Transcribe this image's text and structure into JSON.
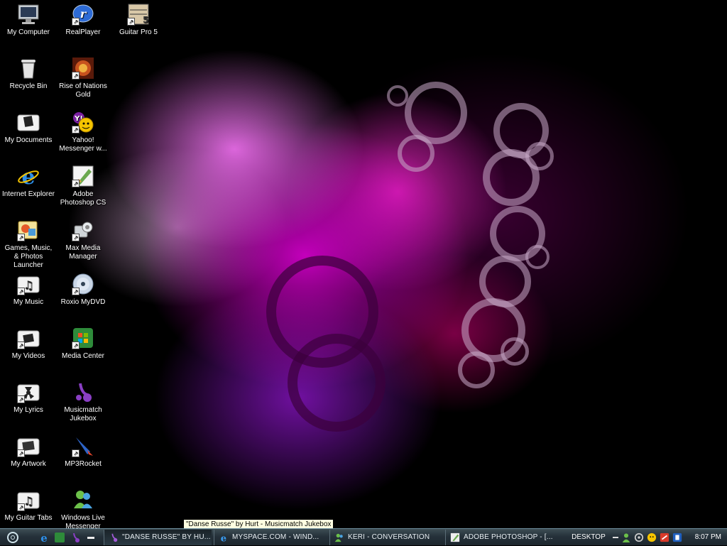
{
  "desktop": {
    "column1": [
      {
        "label": "My Computer",
        "icon": "monitor-icon"
      },
      {
        "label": "Recycle Bin",
        "icon": "recycle-bin-icon"
      },
      {
        "label": "My Documents",
        "icon": "documents-folder-icon"
      },
      {
        "label": "Internet Explorer",
        "icon": "internet-explorer-icon"
      },
      {
        "label": "Games, Music, & Photos Launcher",
        "icon": "launcher-icon"
      },
      {
        "label": "My Music",
        "icon": "music-folder-icon"
      },
      {
        "label": "My Videos",
        "icon": "videos-folder-icon"
      },
      {
        "label": "My Lyrics",
        "icon": "lyrics-folder-icon"
      },
      {
        "label": "My Artwork",
        "icon": "artwork-folder-icon"
      },
      {
        "label": "My Guitar Tabs",
        "icon": "guitar-tabs-folder-icon"
      }
    ],
    "column2": [
      {
        "label": "RealPlayer",
        "icon": "realplayer-icon"
      },
      {
        "label": "Rise of Nations Gold",
        "icon": "rise-of-nations-icon"
      },
      {
        "label": "Yahoo! Messenger w...",
        "icon": "yahoo-messenger-icon"
      },
      {
        "label": "Adobe Photoshop CS",
        "icon": "photoshop-icon"
      },
      {
        "label": "Max Media Manager",
        "icon": "media-manager-icon"
      },
      {
        "label": "Roxio MyDVD",
        "icon": "dvd-icon"
      },
      {
        "label": "Media Center",
        "icon": "media-center-icon"
      },
      {
        "label": "Musicmatch Jukebox",
        "icon": "musicmatch-icon"
      },
      {
        "label": "MP3Rocket",
        "icon": "rocket-icon"
      },
      {
        "label": "Windows Live Messenger",
        "icon": "live-messenger-icon"
      }
    ],
    "column3": [
      {
        "label": "Guitar Pro 5",
        "icon": "guitar-pro-icon"
      }
    ]
  },
  "tooltip": "\"Danse Russe\" by Hurt - Musicmatch Jukebox",
  "taskbar": {
    "tasks": [
      {
        "label": "\"DANSE RUSSE\" BY HU...",
        "icon": "musicmatch-icon",
        "active": true
      },
      {
        "label": "MYSPACE.COM - WIND...",
        "icon": "internet-explorer-icon",
        "active": false
      },
      {
        "label": "KERI - CONVERSATION",
        "icon": "live-messenger-icon",
        "active": false
      },
      {
        "label": "ADOBE PHOTOSHOP - [...",
        "icon": "photoshop-icon",
        "active": false
      }
    ],
    "desktop_label": "DESKTOP",
    "clock": "8:07 PM"
  },
  "colors": {
    "taskbar": "#25313a",
    "tooltip_bg": "#ffffe1",
    "wallpaper_accent": "#e600dc"
  }
}
